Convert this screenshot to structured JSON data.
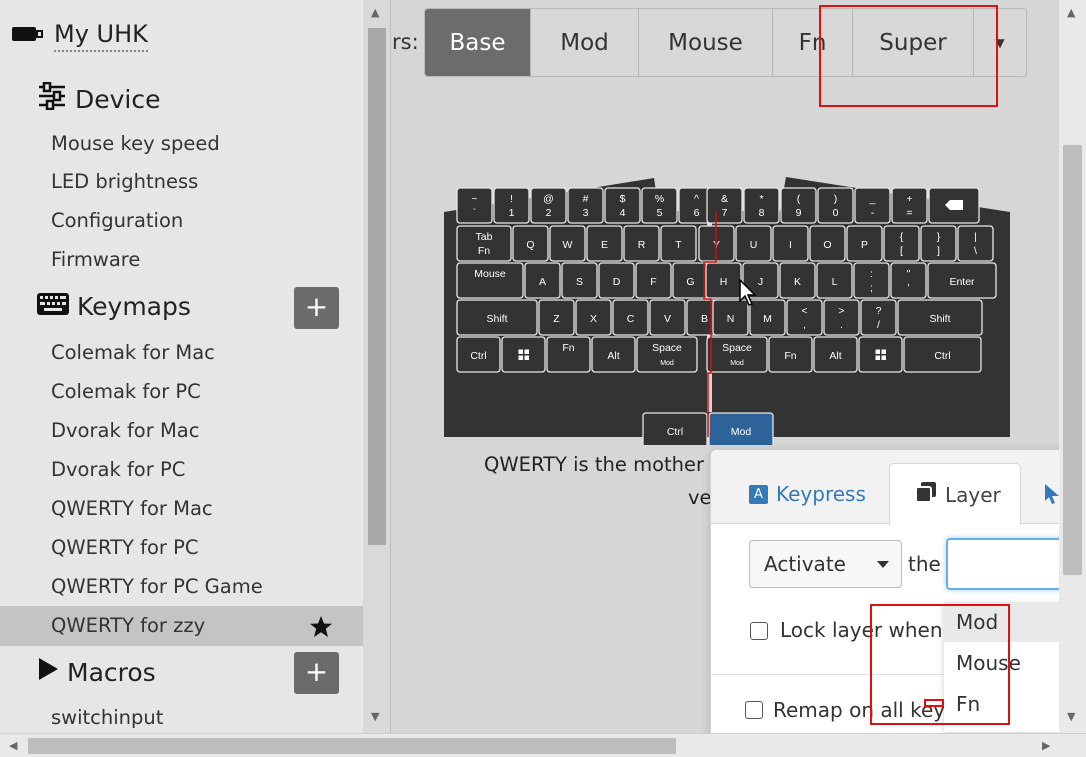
{
  "sidebar": {
    "device_name": "My UHK",
    "device_section": "Device",
    "device_items": [
      "Mouse key speed",
      "LED brightness",
      "Configuration",
      "Firmware"
    ],
    "keymaps_section": "Keymaps",
    "keymaps": [
      "Colemak for Mac",
      "Colemak for PC",
      "Dvorak for Mac",
      "Dvorak for PC",
      "QWERTY for Mac",
      "QWERTY for PC",
      "QWERTY for PC Game",
      "QWERTY for zzy"
    ],
    "macros_section": "Macros",
    "macros": [
      "switchinput"
    ],
    "add_label": "+"
  },
  "main": {
    "layers_label": "rs:",
    "layer_tabs": [
      "Base",
      "Mod",
      "Mouse",
      "Fn",
      "Super"
    ],
    "active_layer": "Base",
    "description_line1": "QWERTY is the mother o",
    "description_line2": "ve"
  },
  "keyboard": {
    "left_rows": [
      [
        {
          "t": "~",
          "b": "`"
        },
        {
          "t": "!",
          "b": "1"
        },
        {
          "t": "@",
          "b": "2"
        },
        {
          "t": "#",
          "b": "3"
        },
        {
          "t": "$",
          "b": "4"
        },
        {
          "t": "%",
          "b": "5"
        },
        {
          "t": "^",
          "b": "6"
        }
      ],
      [
        {
          "t": "Tab",
          "b": "Fn"
        },
        {
          "t": "Q"
        },
        {
          "t": "W"
        },
        {
          "t": "E"
        },
        {
          "t": "R"
        },
        {
          "t": "T"
        }
      ],
      [
        {
          "t": "Mouse",
          "b": ""
        },
        {
          "t": "A"
        },
        {
          "t": "S"
        },
        {
          "t": "D"
        },
        {
          "t": "F"
        },
        {
          "t": "G"
        }
      ],
      [
        {
          "t": "Shift"
        },
        {
          "t": "Z"
        },
        {
          "t": "X"
        },
        {
          "t": "C"
        },
        {
          "t": "V"
        },
        {
          "t": "B"
        }
      ],
      [
        {
          "t": "Ctrl"
        },
        {
          "t": "win-icon"
        },
        {
          "t": "Fn",
          "b": ""
        },
        {
          "t": "Alt"
        },
        {
          "t": "Space",
          "b": "Mod"
        }
      ]
    ],
    "right_rows": [
      [
        {
          "t": "&",
          "b": "7"
        },
        {
          "t": "*",
          "b": "8"
        },
        {
          "t": "(",
          "b": "9"
        },
        {
          "t": ")",
          "b": "0"
        },
        {
          "t": "_",
          "b": "-"
        },
        {
          "t": "+",
          "b": "="
        },
        {
          "t": "backspace-icon"
        }
      ],
      [
        {
          "t": "Y"
        },
        {
          "t": "U"
        },
        {
          "t": "I"
        },
        {
          "t": "O"
        },
        {
          "t": "P"
        },
        {
          "t": "{",
          "b": "["
        },
        {
          "t": "}",
          "b": "]"
        },
        {
          "t": "|",
          "b": "\\"
        }
      ],
      [
        {
          "t": "H"
        },
        {
          "t": "J"
        },
        {
          "t": "K"
        },
        {
          "t": "L"
        },
        {
          "t": ":",
          "b": ";"
        },
        {
          "t": "\"",
          "b": "'"
        },
        {
          "t": "Enter"
        }
      ],
      [
        {
          "t": "N"
        },
        {
          "t": "M"
        },
        {
          "t": "<",
          "b": ","
        },
        {
          "t": ">",
          "b": "."
        },
        {
          "t": "?",
          "b": "/"
        },
        {
          "t": "Shift"
        }
      ],
      [
        {
          "t": "Space",
          "b": "Mod"
        },
        {
          "t": "Fn"
        },
        {
          "t": "Alt"
        },
        {
          "t": "win-icon"
        },
        {
          "t": "Ctrl"
        }
      ]
    ],
    "mod_keys": [
      "Ctrl",
      "Mod"
    ]
  },
  "popover": {
    "tabs": [
      "Keypress",
      "Layer"
    ],
    "active_tab": "Layer",
    "action_select": "Activate",
    "the_label": "the",
    "lock_label": "Lock layer when d",
    "remap_label": "Remap on all keym"
  },
  "layer_dropdown": {
    "options": [
      "Mod",
      "Mouse",
      "Fn"
    ],
    "highlighted": "Mod"
  },
  "colors": {
    "accent": "#337ab7",
    "active_tab": "#6c6c6c",
    "keyboard": "#333333",
    "selected_key": "#2e6399",
    "annotation": "#e01010"
  }
}
